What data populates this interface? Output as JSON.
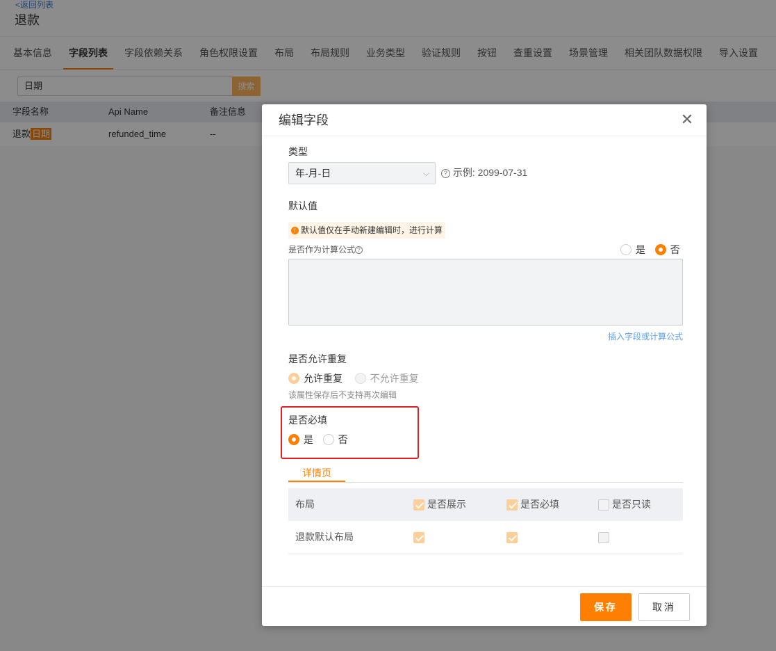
{
  "header": {
    "back_link": "<返回列表",
    "title": "退款"
  },
  "tabs": [
    {
      "label": "基本信息"
    },
    {
      "label": "字段列表"
    },
    {
      "label": "字段依赖关系"
    },
    {
      "label": "角色权限设置"
    },
    {
      "label": "布局"
    },
    {
      "label": "布局规则"
    },
    {
      "label": "业务类型"
    },
    {
      "label": "验证规则"
    },
    {
      "label": "按钮"
    },
    {
      "label": "查重设置"
    },
    {
      "label": "场景管理"
    },
    {
      "label": "相关团队数据权限"
    },
    {
      "label": "导入设置"
    }
  ],
  "active_tab": "字段列表",
  "search": {
    "value": "日期",
    "button": "搜索"
  },
  "table": {
    "columns": [
      "字段名称",
      "Api Name",
      "备注信息"
    ],
    "rows": [
      {
        "name_prefix": "退款",
        "name_highlight": "日期",
        "api_name": "refunded_time",
        "remark": "--"
      }
    ]
  },
  "dialog": {
    "title": "编辑字段",
    "close_icon": "close-icon",
    "type_label": "类型",
    "type_value": "年-月-日",
    "type_example": "示例: 2099-07-31",
    "default_label": "默认值",
    "default_notice": "默认值仅在手动新建编辑时，进行计算",
    "formula_label": "是否作为计算公式",
    "formula_options": [
      "是",
      "否"
    ],
    "formula_selected": "否",
    "insert_link": "插入字段或计算公式",
    "duplicate_label": "是否允许重复",
    "duplicate_options": [
      "允许重复",
      "不允许重复"
    ],
    "duplicate_selected": "允许重复",
    "duplicate_hint": "该属性保存后不支持再次编辑",
    "required_label": "是否必填",
    "required_options": [
      "是",
      "否"
    ],
    "required_selected": "是",
    "subtab": "详情页",
    "grid": {
      "headers": [
        "布局",
        "是否展示",
        "是否必填",
        "是否只读"
      ],
      "header_checked": [
        true,
        true,
        false
      ],
      "rows": [
        {
          "layout": "退款默认布局",
          "show": true,
          "required": true,
          "readonly": false
        }
      ]
    },
    "save_label": "保存",
    "cancel_label": "取消"
  },
  "colors": {
    "accent": "#ff8000",
    "highlight_box": "#e02020",
    "link": "#5aa0e8"
  }
}
